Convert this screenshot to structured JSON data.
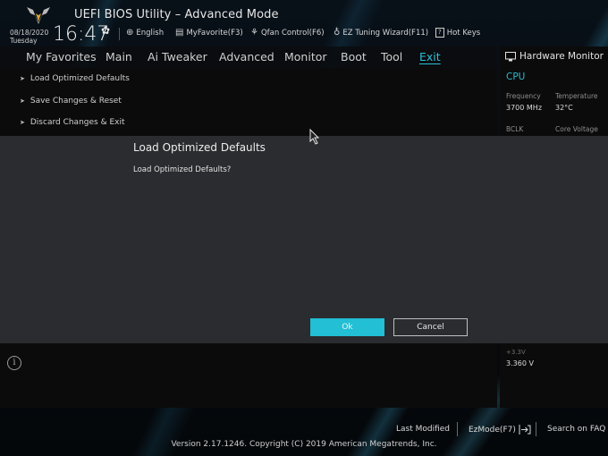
{
  "header": {
    "title": "UEFI BIOS Utility – Advanced Mode",
    "date": "08/18/2020",
    "day": "Tuesday",
    "time": "16:47",
    "buttons": [
      {
        "icon": "globe-icon",
        "label": "English"
      },
      {
        "icon": "favorite-icon",
        "label": "MyFavorite(F3)"
      },
      {
        "icon": "fan-icon",
        "label": "Qfan Control(F6)"
      },
      {
        "icon": "lightbulb-icon",
        "label": "EZ Tuning Wizard(F11)"
      },
      {
        "icon": "help-icon",
        "label": "Hot Keys"
      }
    ]
  },
  "tabs": [
    {
      "label": "My Favorites",
      "active": false
    },
    {
      "label": "Main",
      "active": false
    },
    {
      "label": "Ai Tweaker",
      "active": false
    },
    {
      "label": "Advanced",
      "active": false
    },
    {
      "label": "Monitor",
      "active": false
    },
    {
      "label": "Boot",
      "active": false
    },
    {
      "label": "Tool",
      "active": false
    },
    {
      "label": "Exit",
      "active": true
    }
  ],
  "menu_items": [
    {
      "label": "Load Optimized Defaults"
    },
    {
      "label": "Save Changes & Reset"
    },
    {
      "label": "Discard Changes & Exit"
    }
  ],
  "hardware_monitor": {
    "title": "Hardware Monitor",
    "section": "CPU",
    "frequency_label": "Frequency",
    "frequency_value": "3700 MHz",
    "temperature_label": "Temperature",
    "temperature_value": "32°C",
    "bclk_label": "BCLK",
    "core_voltage_label": "Core Voltage",
    "v33_label": "+3.3V",
    "v33_value": "3.360 V"
  },
  "dialog": {
    "title": "Load Optimized Defaults",
    "message": "Load Optimized Defaults?",
    "ok_label": "Ok",
    "cancel_label": "Cancel"
  },
  "footer": {
    "last_modified": "Last Modified",
    "ez_mode": "EzMode(F7)",
    "search_faq": "Search on FAQ",
    "version": "Version 2.17.1246. Copyright (C) 2019 American Megatrends, Inc."
  },
  "colors": {
    "accent": "#22bfd5",
    "dialog_bg": "#2a2c2f",
    "panel_bg": "#0b0b0b"
  }
}
